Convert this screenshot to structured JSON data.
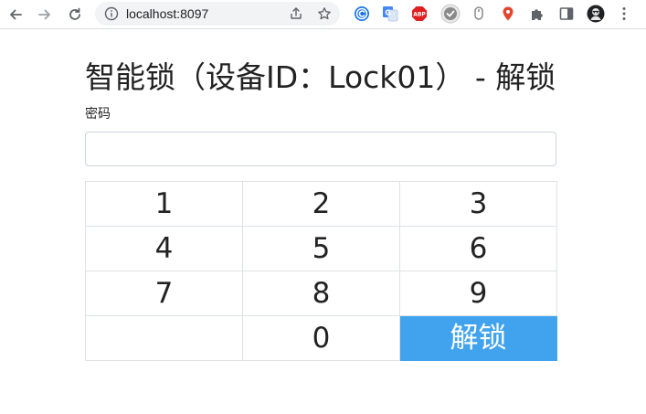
{
  "browser": {
    "url": "localhost:8097",
    "icons": {
      "back": "arrow-left-icon",
      "forward": "arrow-right-icon",
      "reload": "reload-icon",
      "site_info": "info-circle-icon",
      "share": "share-icon",
      "bookmark": "star-icon"
    },
    "extensions": [
      {
        "name": "extension-c-icon",
        "color": "#1a73e8"
      },
      {
        "name": "extension-translate-icon",
        "color": "#4285f4"
      },
      {
        "name": "extension-abp-icon",
        "color": "#e02020",
        "text": "ABP"
      },
      {
        "name": "extension-check-icon",
        "color": "#8a8a8a"
      },
      {
        "name": "extension-mouse-icon",
        "color": "#777777"
      },
      {
        "name": "extension-pin-icon",
        "color": "#e0452e"
      },
      {
        "name": "extensions-puzzle-icon",
        "color": "#5f6368"
      },
      {
        "name": "sidepanel-icon",
        "color": "#5f6368"
      },
      {
        "name": "profile-avatar-icon",
        "color": "#202124"
      },
      {
        "name": "more-menu-icon",
        "color": "#5f6368"
      }
    ]
  },
  "page": {
    "title": "智能锁（设备ID：Lock01） - 解锁",
    "password_label": "密码",
    "password_value": "",
    "accent_color": "#41a3ee"
  },
  "keypad": {
    "rows": [
      [
        "1",
        "2",
        "3"
      ],
      [
        "4",
        "5",
        "6"
      ],
      [
        "7",
        "8",
        "9"
      ],
      [
        "",
        "0",
        "解锁"
      ]
    ]
  }
}
